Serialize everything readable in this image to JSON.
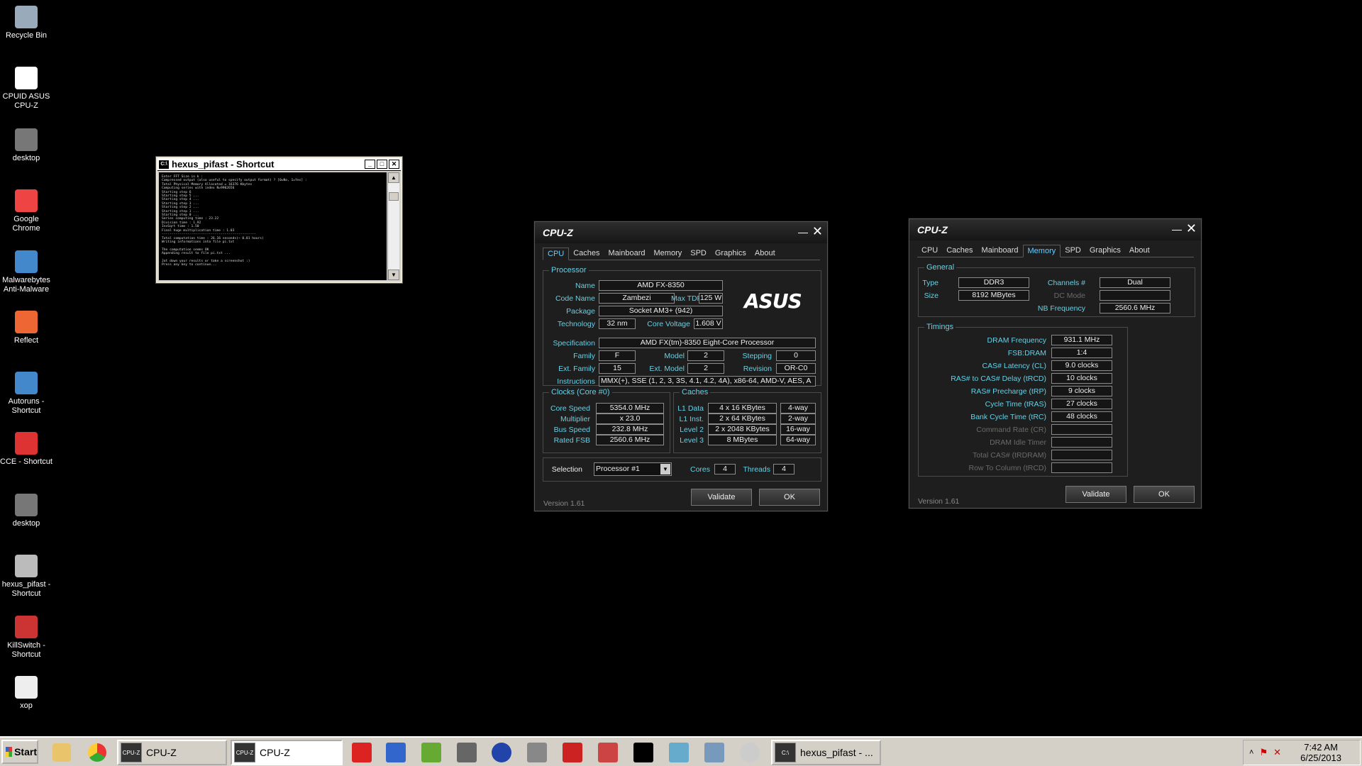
{
  "desktop_icons": [
    {
      "label": "Recycle Bin",
      "icon": "recycle-bin-icon"
    },
    {
      "label": "CPUID ASUS CPU-Z",
      "icon": "cpuz-icon"
    },
    {
      "label": "desktop",
      "icon": "desktop-shortcut-icon"
    },
    {
      "label": "Google Chrome",
      "icon": "chrome-icon"
    },
    {
      "label": "Malwarebytes Anti-Malware",
      "icon": "malwarebytes-icon"
    },
    {
      "label": "Reflect",
      "icon": "reflect-icon"
    },
    {
      "label": "Autoruns - Shortcut",
      "icon": "autoruns-icon"
    },
    {
      "label": "CCE - Shortcut",
      "icon": "cce-icon"
    },
    {
      "label": "desktop",
      "icon": "desktop-shortcut-icon"
    },
    {
      "label": "hexus_pifast - Shortcut",
      "icon": "pifast-icon"
    },
    {
      "label": "KillSwitch - Shortcut",
      "icon": "killswitch-icon"
    },
    {
      "label": "xop",
      "icon": "file-icon"
    }
  ],
  "console": {
    "title": "hexus_pifast - Shortcut",
    "text": "Enter FFT Size in k :\nCompressed output (also useful to specify output format) ? [0=No, 1=Yes] :\nTotal Physical Memory Allocated = 16376 Kbytes\nComputing series with index N=9902656\nStarting step 6\nStarting step 5 ...\nStarting step 4 ...\nStarting step 3 ...\nStarting step 2 ...\nStarting step 1 ...\nStarting step 0 ...\nSeries computing time : 23.22\nDivision time : 1.92\nInvSqrt time : 1.50\nFinal huge multiplication time : 1.03\n------------------------------------------------\nTotal computation time : 26.16 seconds(~ 0.01 hours)\nWriting informations into file pi.txt\n\nThe computation seems OK\nAppending result to file pi.txt ...\n\nJot down your results or take a screenshot :)\nPress any key to continue..."
  },
  "cpuz_cpu": {
    "title": "CPU-Z",
    "tabs": [
      "CPU",
      "Caches",
      "Mainboard",
      "Memory",
      "SPD",
      "Graphics",
      "About"
    ],
    "active_tab": "CPU",
    "processor_legend": "Processor",
    "labels": {
      "name": "Name",
      "code_name": "Code Name",
      "max_tdp": "Max TDP",
      "package": "Package",
      "technology": "Technology",
      "core_voltage": "Core Voltage",
      "specification": "Specification",
      "family": "Family",
      "model": "Model",
      "stepping": "Stepping",
      "ext_family": "Ext. Family",
      "ext_model": "Ext. Model",
      "revision": "Revision",
      "instructions": "Instructions"
    },
    "values": {
      "name": "AMD FX-8350",
      "code_name": "Zambezi",
      "max_tdp": "125 W",
      "package": "Socket AM3+ (942)",
      "technology": "32 nm",
      "core_voltage": "1.608 V",
      "specification": "AMD FX(tm)-8350 Eight-Core Processor",
      "family": "F",
      "model": "2",
      "stepping": "0",
      "ext_family": "15",
      "ext_model": "2",
      "revision": "OR-C0",
      "instructions": "MMX(+), SSE (1, 2, 3, 3S, 4.1, 4.2, 4A), x86-64, AMD-V, AES, A"
    },
    "brand_logo": "ASUS",
    "clocks_legend": "Clocks (Core #0)",
    "clocks": [
      {
        "label": "Core Speed",
        "value": "5354.0 MHz"
      },
      {
        "label": "Multiplier",
        "value": "x 23.0"
      },
      {
        "label": "Bus Speed",
        "value": "232.8 MHz"
      },
      {
        "label": "Rated FSB",
        "value": "2560.6 MHz"
      }
    ],
    "caches_legend": "Caches",
    "caches": [
      {
        "label": "L1 Data",
        "size": "4 x 16 KBytes",
        "ways": "4-way"
      },
      {
        "label": "L1 Inst.",
        "size": "2 x 64 KBytes",
        "ways": "2-way"
      },
      {
        "label": "Level 2",
        "size": "2 x 2048 KBytes",
        "ways": "16-way"
      },
      {
        "label": "Level 3",
        "size": "8 MBytes",
        "ways": "64-way"
      }
    ],
    "selection_label": "Selection",
    "selection_value": "Processor #1",
    "cores_label": "Cores",
    "cores_value": "4",
    "threads_label": "Threads",
    "threads_value": "4",
    "version": "Version 1.61",
    "validate_label": "Validate",
    "ok_label": "OK"
  },
  "cpuz_mem": {
    "title": "CPU-Z",
    "tabs": [
      "CPU",
      "Caches",
      "Mainboard",
      "Memory",
      "SPD",
      "Graphics",
      "About"
    ],
    "active_tab": "Memory",
    "general_legend": "General",
    "type_label": "Type",
    "type_value": "DDR3",
    "size_label": "Size",
    "size_value": "8192 MBytes",
    "channels_label": "Channels #",
    "channels_value": "Dual",
    "dc_mode_label": "DC Mode",
    "dc_mode_value": "",
    "nb_freq_label": "NB Frequency",
    "nb_freq_value": "2560.6 MHz",
    "timings_legend": "Timings",
    "timings": [
      {
        "label": "DRAM Frequency",
        "value": "931.1 MHz",
        "dim": false
      },
      {
        "label": "FSB:DRAM",
        "value": "1:4",
        "dim": false
      },
      {
        "label": "CAS# Latency (CL)",
        "value": "9.0 clocks",
        "dim": false
      },
      {
        "label": "RAS# to CAS# Delay (tRCD)",
        "value": "10 clocks",
        "dim": false
      },
      {
        "label": "RAS# Precharge (tRP)",
        "value": "9 clocks",
        "dim": false
      },
      {
        "label": "Cycle Time (tRAS)",
        "value": "27 clocks",
        "dim": false
      },
      {
        "label": "Bank Cycle Time (tRC)",
        "value": "48 clocks",
        "dim": false
      },
      {
        "label": "Command Rate (CR)",
        "value": "",
        "dim": true
      },
      {
        "label": "DRAM Idle Timer",
        "value": "",
        "dim": true
      },
      {
        "label": "Total CAS# (tRDRAM)",
        "value": "",
        "dim": true
      },
      {
        "label": "Row To Column (tRCD)",
        "value": "",
        "dim": true
      }
    ],
    "version": "Version 1.61",
    "validate_label": "Validate",
    "ok_label": "OK"
  },
  "taskbar": {
    "start_label": "Start",
    "tasks": [
      {
        "label": "CPU-Z",
        "active": false
      },
      {
        "label": "CPU-Z",
        "active": true
      },
      {
        "label": "hexus_pifast - ...",
        "active": false
      }
    ],
    "quick_icons": [
      "explorer-icon",
      "chrome-icon"
    ],
    "app_icons": [
      "ccleaner-icon",
      "superpi-icon",
      "hwmonitor-icon",
      "uc-icon",
      "globe-icon",
      "gear-app-icon",
      "cce-icon",
      "killswitch-icon",
      "crosshair-icon",
      "paint-icon",
      "network-icon",
      "clock-app-icon"
    ],
    "tray_icons": [
      "chevron-up-icon",
      "flag-icon",
      "volume-mute-icon"
    ],
    "time": "7:42 AM",
    "date": "6/25/2013"
  }
}
